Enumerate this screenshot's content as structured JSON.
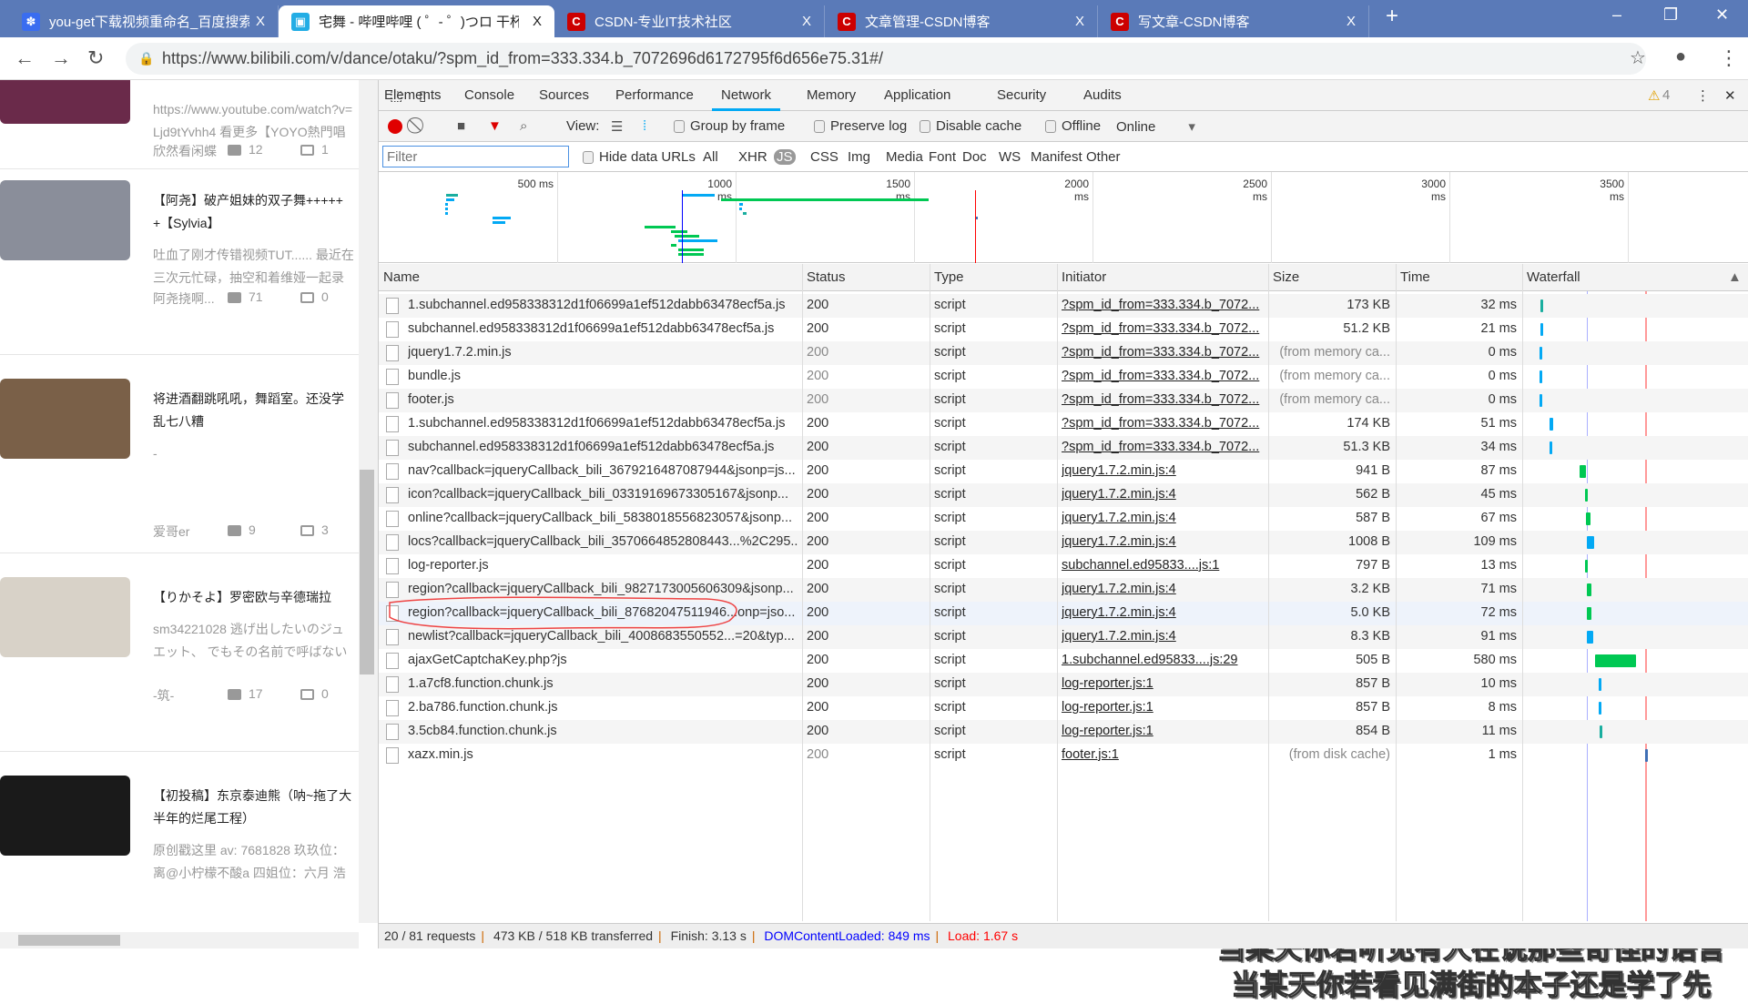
{
  "browser": {
    "tabs": [
      {
        "title": "you-get下载视频重命名_百度搜索",
        "icon": "baidu-paw-icon",
        "active": false
      },
      {
        "title": "宅舞 - 哔哩哔哩 ( ゜- ゜)つロ 干杯~",
        "icon": "bilibili-tv-icon",
        "active": true
      },
      {
        "title": "CSDN-专业IT技术社区",
        "icon": "csdn-c-icon",
        "active": false
      },
      {
        "title": "文章管理-CSDN博客",
        "icon": "csdn-c-icon",
        "active": false
      },
      {
        "title": "写文章-CSDN博客",
        "icon": "csdn-c-icon",
        "active": false
      }
    ],
    "close_glyph": "X",
    "new_tab": "+",
    "url": "https://www.bilibili.com/v/dance/otaku/?spm_id_from=333.334.b_7072696d6172795f6d656e75.31#/"
  },
  "page": {
    "cards": [
      {
        "title": "",
        "desc": [
          "https://www.youtube.com/watch?v=",
          "Ljd9tYvhh4 看更多【YOYO熱門唱"
        ],
        "author": "欣然看闲蝶",
        "plays": "12",
        "comments": "1",
        "thumb": "#6a2a4a"
      },
      {
        "title": "【阿尧】破产姐妹的双子舞+++++",
        "title2": "+【Sylvia】",
        "desc": [
          "吐血了刚才传错视频TUT...... 最近在",
          "三次元忙碌，抽空和着维娅一起录"
        ],
        "author": "阿尧挠啊...",
        "plays": "71",
        "comments": "0",
        "thumb": "#8a8e9a"
      },
      {
        "title": "将进酒翻跳吼吼，舞蹈室。还没学",
        "title2": "乱七八糟",
        "desc": [
          "-"
        ],
        "author": "爱哥er",
        "plays": "9",
        "comments": "3",
        "thumb": "#7a6048"
      },
      {
        "title": "【りかそよ】罗密欧与辛德瑞拉",
        "desc": [
          "sm34221028 逃げ出したいのジュ",
          "エット、 でもその名前で呼ばない"
        ],
        "author": "-筑-",
        "plays": "17",
        "comments": "0",
        "thumb": "#d8d2c8"
      },
      {
        "title": "【初投稿】东京泰迪熊（呐~拖了大",
        "title2": "半年的烂尾工程）",
        "desc": [
          "原创戳这里 av: 7681828 玖玖位：",
          "离@小柠檬不酸a 四姐位：六月 浩"
        ],
        "author": "",
        "plays": "",
        "comments": "",
        "thumb": "#1a1a1a"
      }
    ]
  },
  "devtools": {
    "tabs": [
      "Elements",
      "Console",
      "Sources",
      "Performance",
      "Network",
      "Memory",
      "Application",
      "Security",
      "Audits"
    ],
    "active_tab": "Network",
    "warnings": "4",
    "toolbar": {
      "view": "View:",
      "group_by_frame": "Group by frame",
      "preserve_log": "Preserve log",
      "disable_cache": "Disable cache",
      "offline": "Offline",
      "throttle": "Online"
    },
    "filter": {
      "placeholder": "Filter",
      "hide_data_urls": "Hide data URLs",
      "types": [
        "All",
        "XHR",
        "JS",
        "CSS",
        "Img",
        "Media",
        "Font",
        "Doc",
        "WS",
        "Manifest",
        "Other"
      ],
      "active_type": "JS"
    },
    "overview_ticks": [
      "500 ms",
      "1000 ms",
      "1500 ms",
      "2000 ms",
      "2500 ms",
      "3000 ms",
      "3500 ms"
    ],
    "columns": [
      "Name",
      "Status",
      "Type",
      "Initiator",
      "Size",
      "Time",
      "Waterfall"
    ],
    "rows": [
      {
        "name": "1.subchannel.ed958338312d1f06699a1ef512dabb63478ecf5a.js",
        "status": "200",
        "type": "script",
        "initiator": "?spm_id_from=333.334.b_7072...",
        "size": "173 KB",
        "time": "32 ms",
        "start": 190,
        "dur": 32,
        "color": "#1aae9f"
      },
      {
        "name": "subchannel.ed958338312d1f06699a1ef512dabb63478ecf5a.js",
        "status": "200",
        "type": "script",
        "initiator": "?spm_id_from=333.334.b_7072...",
        "size": "51.2 KB",
        "time": "21 ms",
        "start": 190,
        "dur": 21,
        "color": "#03a9f4"
      },
      {
        "name": "jquery1.7.2.min.js",
        "status": "200",
        "type": "script",
        "initiator": "?spm_id_from=333.334.b_7072...",
        "size": "(from memory ca...",
        "time": "0 ms",
        "start": 185,
        "dur": 0,
        "color": "#03a9f4",
        "cached": true
      },
      {
        "name": "bundle.js",
        "status": "200",
        "type": "script",
        "initiator": "?spm_id_from=333.334.b_7072...",
        "size": "(from memory ca...",
        "time": "0 ms",
        "start": 185,
        "dur": 0,
        "color": "#03a9f4",
        "cached": true
      },
      {
        "name": "footer.js",
        "status": "200",
        "type": "script",
        "initiator": "?spm_id_from=333.334.b_7072...",
        "size": "(from memory ca...",
        "time": "0 ms",
        "start": 185,
        "dur": 0,
        "color": "#03a9f4",
        "cached": true
      },
      {
        "name": "1.subchannel.ed958338312d1f06699a1ef512dabb63478ecf5a.js",
        "status": "200",
        "type": "script",
        "initiator": "?spm_id_from=333.334.b_7072...",
        "size": "174 KB",
        "time": "51 ms",
        "start": 320,
        "dur": 51,
        "color": "#03a9f4"
      },
      {
        "name": "subchannel.ed958338312d1f06699a1ef512dabb63478ecf5a.js",
        "status": "200",
        "type": "script",
        "initiator": "?spm_id_from=333.334.b_7072...",
        "size": "51.3 KB",
        "time": "34 ms",
        "start": 320,
        "dur": 34,
        "color": "#03a9f4"
      },
      {
        "name": "nav?callback=jqueryCallback_bili_3679216487087944&jsonp=js...",
        "status": "200",
        "type": "script",
        "initiator": "jquery1.7.2.min.js:4",
        "size": "941 B",
        "time": "87 ms",
        "start": 745,
        "dur": 87,
        "color": "#00c853"
      },
      {
        "name": "icon?callback=jqueryCallback_bili_03319169673305167&jsonp...",
        "status": "200",
        "type": "script",
        "initiator": "jquery1.7.2.min.js:4",
        "size": "562 B",
        "time": "45 ms",
        "start": 820,
        "dur": 45,
        "color": "#00c853"
      },
      {
        "name": "online?callback=jqueryCallback_bili_5838018556823057&jsonp...",
        "status": "200",
        "type": "script",
        "initiator": "jquery1.7.2.min.js:4",
        "size": "587 B",
        "time": "67 ms",
        "start": 830,
        "dur": 67,
        "color": "#00c853"
      },
      {
        "name": "locs?callback=jqueryCallback_bili_3570664852808443...%2C295...",
        "status": "200",
        "type": "script",
        "initiator": "jquery1.7.2.min.js:4",
        "size": "1008 B",
        "time": "109 ms",
        "start": 840,
        "dur": 109,
        "color": "#03a9f4"
      },
      {
        "name": "log-reporter.js",
        "status": "200",
        "type": "script",
        "initiator": "subchannel.ed95833....js:1",
        "size": "797 B",
        "time": "13 ms",
        "start": 820,
        "dur": 13,
        "color": "#00c853"
      },
      {
        "name": "region?callback=jqueryCallback_bili_9827173005606309&jsonp...",
        "status": "200",
        "type": "script",
        "initiator": "jquery1.7.2.min.js:4",
        "size": "3.2 KB",
        "time": "71 ms",
        "start": 840,
        "dur": 71,
        "color": "#00c853"
      },
      {
        "name": "region?callback=jqueryCallback_bili_87682047511946...onp=jso...",
        "status": "200",
        "type": "script",
        "initiator": "jquery1.7.2.min.js:4",
        "size": "5.0 KB",
        "time": "72 ms",
        "start": 840,
        "dur": 72,
        "color": "#00c853",
        "selected": true
      },
      {
        "name": "newlist?callback=jqueryCallback_bili_4008683550552...=20&typ...",
        "status": "200",
        "type": "script",
        "initiator": "jquery1.7.2.min.js:4",
        "size": "8.3 KB",
        "time": "91 ms",
        "start": 850,
        "dur": 91,
        "color": "#03a9f4",
        "annotated": true
      },
      {
        "name": "ajaxGetCaptchaKey.php?js",
        "status": "200",
        "type": "script",
        "initiator": "1.subchannel.ed95833....js:29",
        "size": "505 B",
        "time": "580 ms",
        "start": 960,
        "dur": 580,
        "color": "#00c853"
      },
      {
        "name": "1.a7cf8.function.chunk.js",
        "status": "200",
        "type": "script",
        "initiator": "log-reporter.js:1",
        "size": "857 B",
        "time": "10 ms",
        "start": 1010,
        "dur": 10,
        "color": "#03a9f4"
      },
      {
        "name": "2.ba786.function.chunk.js",
        "status": "200",
        "type": "script",
        "initiator": "log-reporter.js:1",
        "size": "857 B",
        "time": "8 ms",
        "start": 1010,
        "dur": 8,
        "color": "#03a9f4"
      },
      {
        "name": "3.5cb84.function.chunk.js",
        "status": "200",
        "type": "script",
        "initiator": "log-reporter.js:1",
        "size": "854 B",
        "time": "11 ms",
        "start": 1020,
        "dur": 11,
        "color": "#1aae9f"
      },
      {
        "name": "xazx.min.js",
        "status": "200",
        "type": "script",
        "initiator": "footer.js:1",
        "size": "(from disk cache)",
        "time": "1 ms",
        "start": 1670,
        "dur": 1,
        "color": "#3f6fb5",
        "cached": true
      }
    ],
    "dom_content_loaded_ms": 849,
    "load_ms": 1670,
    "status": {
      "requests": "20 / 81 requests",
      "transferred": "473 KB / 518 KB transferred",
      "finish": "Finish: 3.13 s",
      "dcl": "DOMContentLoaded: 849 ms",
      "load": "Load: 1.67 s"
    },
    "colors": {
      "dcl": "#0000ff",
      "load": "#ff0000",
      "accent": "#03a9f4",
      "record": "#e00000"
    }
  },
  "subtitles": [
    "当某天你若听见有人在说那些奇怪的语言",
    "当某天你若看见满街的本子还是学了先"
  ]
}
